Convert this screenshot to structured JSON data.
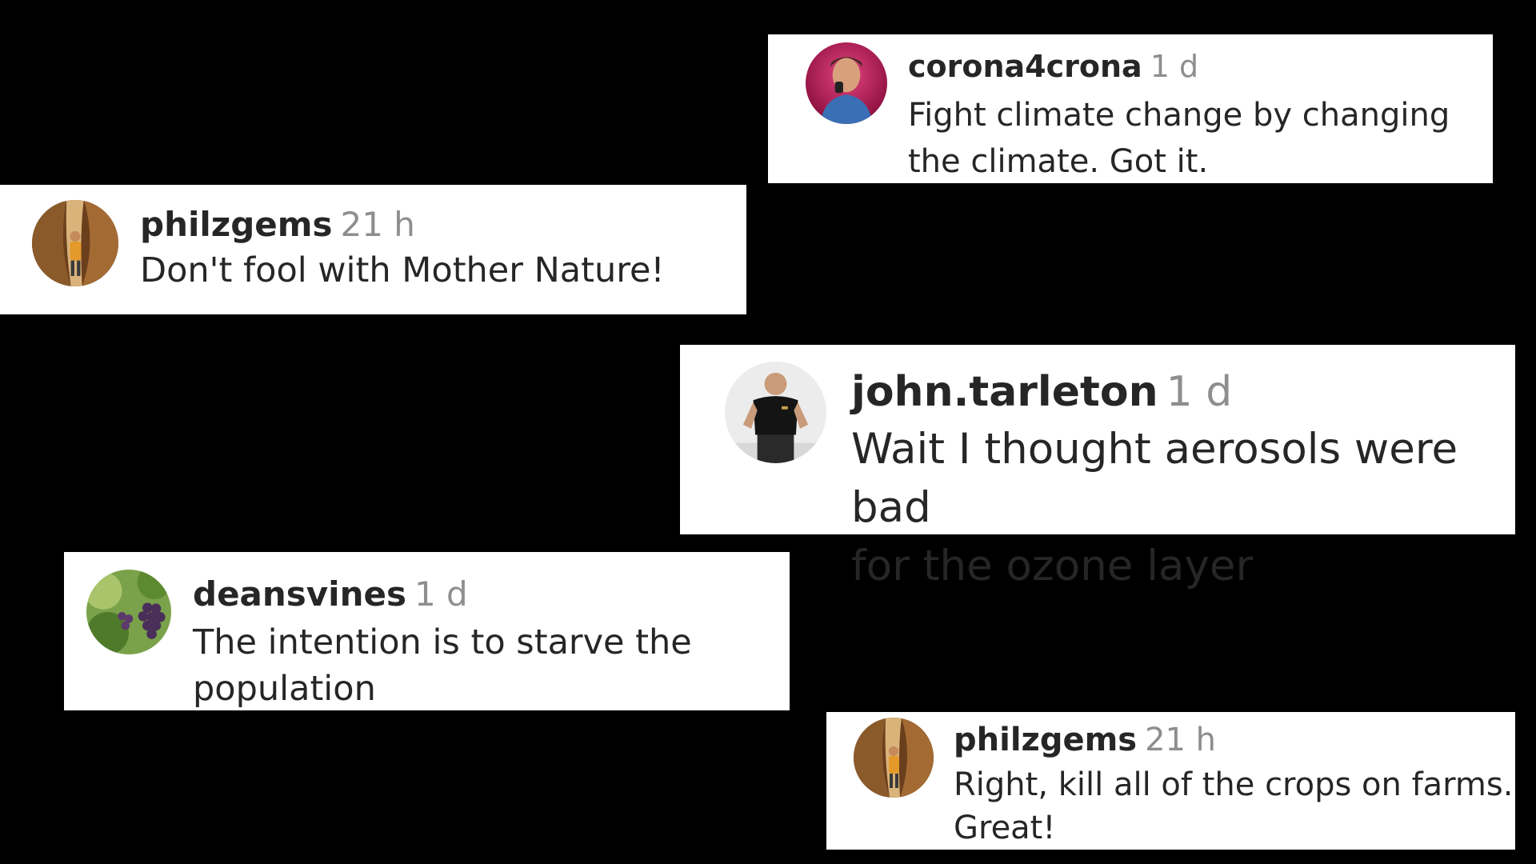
{
  "comments": [
    {
      "username": "corona4crona",
      "time": "1 d",
      "text": "Fight climate change by changing\nthe climate. Got it.",
      "avatar_icon": "person-portrait-icon",
      "avatar_colors": [
        "#c0175a",
        "#3a6fb5"
      ]
    },
    {
      "username": "philzgems",
      "time": "21 h",
      "text": "Don't fool with Mother Nature!",
      "avatar_icon": "person-in-canyon-icon",
      "avatar_colors": [
        "#7a4a22",
        "#e39a2a"
      ]
    },
    {
      "username": "john.tarleton",
      "time": "1 d",
      "text": "Wait I thought aerosols were bad\nfor the ozone layer",
      "avatar_icon": "man-in-black-shirt-icon",
      "avatar_colors": [
        "#eeeeee",
        "#111111"
      ]
    },
    {
      "username": "deansvines",
      "time": "1 d",
      "text": "The intention is to starve the\npopulation",
      "avatar_icon": "grape-vine-icon",
      "avatar_colors": [
        "#5f8a3a",
        "#4a2f5a"
      ]
    },
    {
      "username": "philzgems",
      "time": "21 h",
      "text": "Right, kill all of the crops on farms.\nGreat!",
      "avatar_icon": "person-in-canyon-icon",
      "avatar_colors": [
        "#7a4a22",
        "#e39a2a"
      ]
    }
  ],
  "colors": {
    "background": "#000000",
    "card": "#ffffff",
    "username": "#262626",
    "timestamp": "#8e8e8e",
    "text": "#262626"
  }
}
